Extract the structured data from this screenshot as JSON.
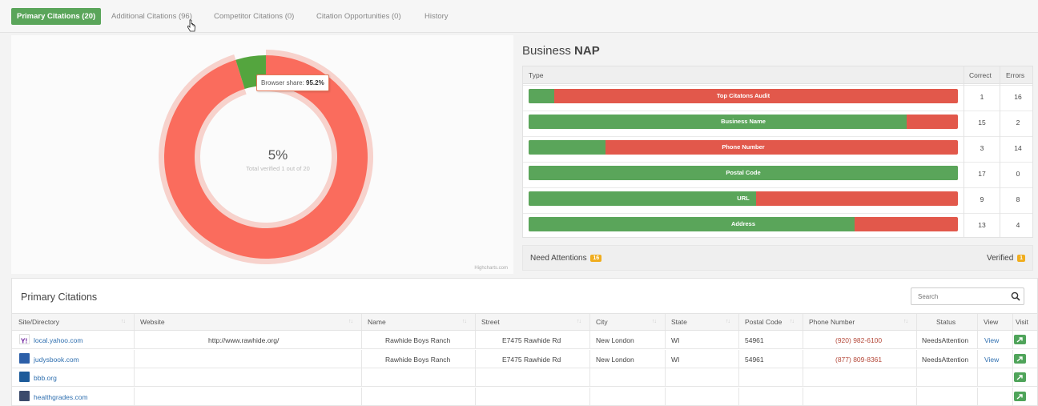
{
  "tabs": [
    {
      "label": "Primary Citations (20)",
      "active": true
    },
    {
      "label": "Additional Citations (96)",
      "active": false
    },
    {
      "label": "Competitor Citations (0)",
      "active": false
    },
    {
      "label": "Citation Opportunities (0)",
      "active": false
    },
    {
      "label": "History",
      "active": false
    }
  ],
  "donut": {
    "center_value": "5%",
    "center_label": "Total verified 1 out of 20",
    "verified_fraction": 0.048,
    "tooltip_label": "Browser share:",
    "tooltip_value": "95.2%",
    "credits": "Highcharts.com",
    "colors": {
      "main": "#fa6c5d",
      "verified": "#54a53e",
      "halo": "#f7d2cc"
    }
  },
  "nap": {
    "title_prefix": "Business ",
    "title_bold": "NAP",
    "headers": {
      "type": "Type",
      "correct": "Correct",
      "errors": "Errors"
    },
    "rows": [
      {
        "label": "Top Citatons Audit",
        "correct": "1",
        "errors": "16",
        "green_fraction": 0.06
      },
      {
        "label": "Business Name",
        "correct": "15",
        "errors": "2",
        "green_fraction": 0.88
      },
      {
        "label": "Phone Number",
        "correct": "3",
        "errors": "14",
        "green_fraction": 0.18
      },
      {
        "label": "Postal Code",
        "correct": "17",
        "errors": "0",
        "green_fraction": 1.0
      },
      {
        "label": "URL",
        "correct": "9",
        "errors": "8",
        "green_fraction": 0.53
      },
      {
        "label": "Address",
        "correct": "13",
        "errors": "4",
        "green_fraction": 0.76
      }
    ],
    "colors": {
      "correct": "#5aa55a",
      "error": "#e2584b"
    }
  },
  "attention": {
    "need_label": "Need Attentions",
    "need_count": "16",
    "verified_label": "Verified",
    "verified_count": "1"
  },
  "primary_citations": {
    "title": "Primary Citations",
    "search_placeholder": "Search",
    "columns": [
      "Site/Directory",
      "Website",
      "Name",
      "Street",
      "City",
      "State",
      "Postal Code",
      "Phone Number",
      "Status",
      "View",
      "Visit"
    ],
    "rows": [
      {
        "site": "local.yahoo.com",
        "icon": "yahoo-icon",
        "icon_color": "#ffffff",
        "website": "http://www.rawhide.org/",
        "name": "Rawhide Boys Ranch",
        "street": "E7475 Rawhide Rd",
        "city": "New London",
        "state": "WI",
        "postal": "54961",
        "phone": "(920) 982-6100",
        "status": "NeedsAttention",
        "view": "View"
      },
      {
        "site": "judysbook.com",
        "icon": "judysbook-icon",
        "icon_color": "#2c5fa8",
        "website": "",
        "name": "Rawhide Boys Ranch",
        "street": "E7475 Rawhide Rd",
        "city": "New London",
        "state": "WI",
        "postal": "54961",
        "phone": "(877) 809-8361",
        "status": "NeedsAttention",
        "view": "View"
      },
      {
        "site": "bbb.org",
        "icon": "bbb-icon",
        "icon_color": "#1d5b9a",
        "website": "",
        "name": "",
        "street": "",
        "city": "",
        "state": "",
        "postal": "",
        "phone": "",
        "status": "",
        "view": ""
      },
      {
        "site": "healthgrades.com",
        "icon": "healthgrades-icon",
        "icon_color": "#3b4a6b",
        "website": "",
        "name": "",
        "street": "",
        "city": "",
        "state": "",
        "postal": "",
        "phone": "",
        "status": "",
        "view": ""
      }
    ]
  }
}
